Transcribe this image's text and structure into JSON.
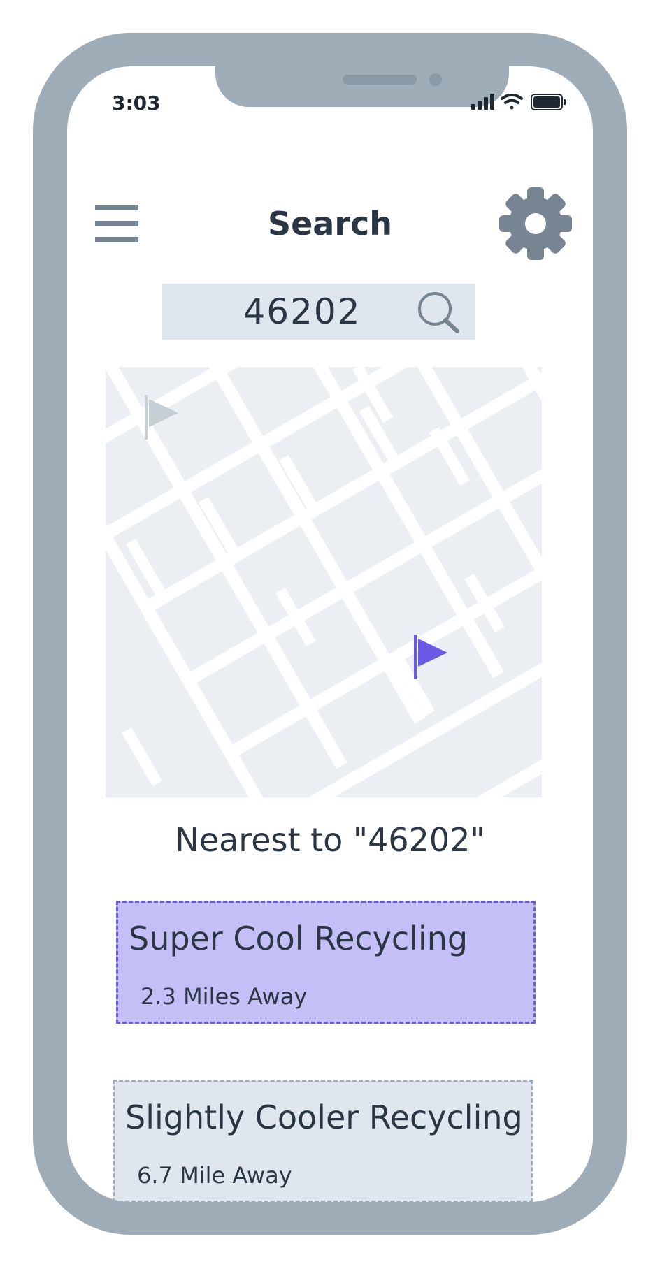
{
  "status_bar": {
    "time": "3:03"
  },
  "header": {
    "title": "Search"
  },
  "search": {
    "value": "46202"
  },
  "results": {
    "heading": "Nearest to \"46202\"",
    "items": [
      {
        "name": "Super Cool Recycling",
        "distance": "2.3 Miles Away",
        "selected": true
      },
      {
        "name": "Slightly Cooler Recycling",
        "distance": "6.7 Mile Away",
        "selected": false
      }
    ]
  },
  "colors": {
    "frame": "#9eacb8",
    "accent": "#6a5be6",
    "selected_card": "#c4c0f7",
    "card": "#e0e6ed",
    "map_bg": "#ebeef2",
    "text": "#2b3645"
  },
  "icons": [
    "menu-icon",
    "gear-icon",
    "search-icon",
    "map-marker-icon",
    "signal-icon",
    "wifi-icon",
    "battery-icon"
  ]
}
